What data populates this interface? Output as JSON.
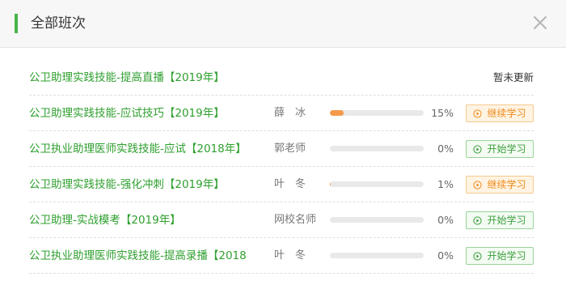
{
  "dialog": {
    "title": "全部班次",
    "close_icon": "close-icon",
    "accent_color": "#4ab44a"
  },
  "courses": [
    {
      "title": "公卫助理实践技能-提高直播【2019年】",
      "teacher": "",
      "progress": null,
      "percent": "",
      "status": "暂未更新",
      "action": null,
      "action_type": ""
    },
    {
      "title": "公卫助理实践技能-应试技巧【2019年】",
      "teacher": "薛　冰",
      "progress": 0.15,
      "percent": "15%",
      "status": "",
      "action": "继续学习",
      "action_type": "continue"
    },
    {
      "title": "公卫执业助理医师实践技能-应试【2018年】",
      "teacher": "郭老师",
      "progress": 0,
      "percent": "0%",
      "status": "",
      "action": "开始学习",
      "action_type": "start"
    },
    {
      "title": "公卫助理实践技能-强化冲刺【2019年】",
      "teacher": "叶　冬",
      "progress": 0.01,
      "percent": "1%",
      "status": "",
      "action": "继续学习",
      "action_type": "continue"
    },
    {
      "title": "公卫助理-实战模考【2019年】",
      "teacher": "网校名师",
      "progress": 0,
      "percent": "0%",
      "status": "",
      "action": "开始学习",
      "action_type": "start"
    },
    {
      "title": "公卫执业助理医师实践技能-提高录播【2018",
      "teacher": "叶　冬",
      "progress": 0,
      "percent": "0%",
      "status": "",
      "action": "开始学习",
      "action_type": "start"
    }
  ],
  "colors": {
    "title_green": "#2e9f2e",
    "progress_fill": "#f39a4c",
    "continue_btn": "#ef8a1d",
    "start_btn": "#3d9f3d"
  },
  "icons": {
    "action_button": "play-circle-icon"
  }
}
